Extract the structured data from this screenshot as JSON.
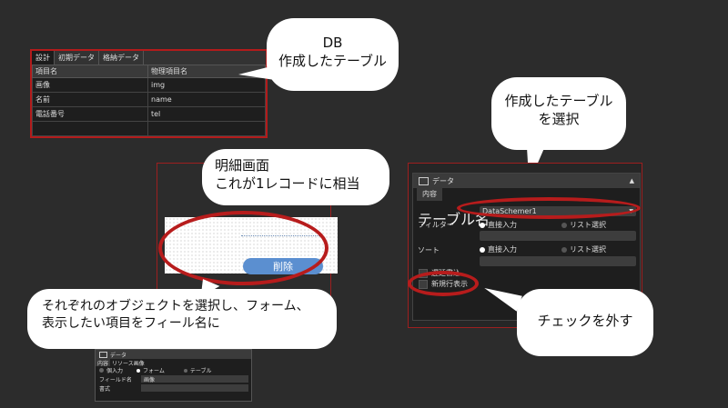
{
  "db_panel": {
    "tabs": [
      "設計",
      "初期データ",
      "格納データ"
    ],
    "headers": [
      "項目名",
      "物理項目名"
    ],
    "rows": [
      [
        "画像",
        "img"
      ],
      [
        "名前",
        "name"
      ],
      [
        "電話番号",
        "tel"
      ],
      [
        "",
        ""
      ]
    ]
  },
  "bubbles": {
    "db_line1": "DB",
    "db_line2": "作成したテーブル",
    "select_line1": "作成したテーブル",
    "select_line2": "を選択",
    "detail_line1": "明細画面",
    "detail_line2": "これが1レコードに相当",
    "object_line1": "それぞれのオブジェクトを選択し、フォーム、",
    "object_line2": "表示したい項目をフィール名に",
    "uncheck": "チェックを外す"
  },
  "detail": {
    "delete_label": "削除"
  },
  "prop_panel": {
    "title": "データ",
    "tab": "内容",
    "table_label": "テーブル名",
    "table_value": "DataSchemer1",
    "filter_label": "フィルター",
    "sort_label": "ソート",
    "direct_input": "直接入力",
    "list_select": "リスト選択",
    "deferred_write": "遅延書込",
    "new_row_display": "新規行表示"
  },
  "mini_panel": {
    "title": "データ",
    "tabs": [
      "内容",
      "リソース画像"
    ],
    "opt_single": "個入力",
    "opt_form": "フォーム",
    "opt_table": "テーブル",
    "field_label": "フィールド名",
    "field_value": "画像",
    "format_label": "書式"
  },
  "colors": {
    "accent_red": "#b71c1c",
    "button_blue": "#5b8fd0"
  }
}
